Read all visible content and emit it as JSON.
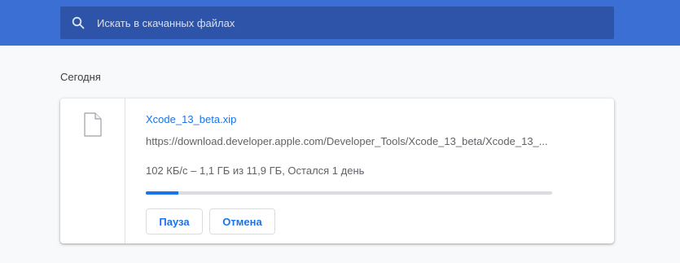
{
  "search": {
    "placeholder": "Искать в скачанных файлах",
    "icon": "search-icon"
  },
  "sections": [
    {
      "title": "Сегодня",
      "downloads": [
        {
          "icon": "file-icon",
          "file_name": "Xcode_13_beta.xip",
          "url": "https://download.developer.apple.com/Developer_Tools/Xcode_13_beta/Xcode_13_...",
          "status": "102 КБ/с – 1,1 ГБ из 11,9 ГБ, Остался 1 день",
          "progress_fraction": 0.08,
          "buttons": {
            "pause_label": "Пауза",
            "cancel_label": "Отмена"
          }
        }
      ]
    }
  ],
  "colors": {
    "header": "#3b6fd4",
    "search_bg": "#2d54a8",
    "accent": "#1a73e8"
  }
}
